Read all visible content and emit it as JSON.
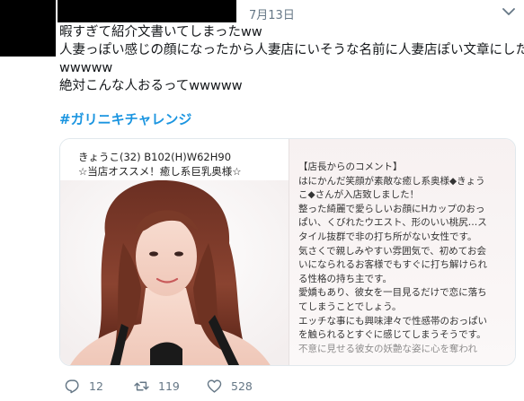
{
  "tweet": {
    "date": "7月13日",
    "lines": [
      "暇すぎて紹介文書いてしまったww",
      "人妻っぽい感じの顔になったから人妻店にいそうな名前に人妻店ぽい文章にした",
      "wwwww",
      "絶対こんな人おるってwwwww"
    ],
    "hashtag": "#ガリニキチャレンジ"
  },
  "media": {
    "profile_name": "きょうこ(32) B102(H)W62H90",
    "profile_tag": "☆当店オススメ！癒し系巨乳奥様☆",
    "comment_lines": [
      "【店長からのコメント】",
      "はにかんだ笑顔が素敵な癒し系奥様◆きょう",
      "こ◆さんが入店致しました！",
      "整った綺麗で愛らしいお顔にHカップのおっ",
      "ぱい、くびれたウエスト、形のいい桃尻…ス",
      "タイル抜群で非の打ち所がない女性です。",
      "気さくで親しみやすい雰囲気で、初めてお会",
      "いになられるお客様でもすぐに打ち解けられ",
      "る性格の持ち主です。",
      "愛嬌もあり、彼女を一目見るだけで恋に落ち",
      "てしまうことでしょう。",
      "エッチな事にも興味津々で性感帯のおっぱい",
      "を触られるとすぐに感じてしまうそうです。",
      "不意に見せる彼女の妖艶な姿に心を奪われ"
    ]
  },
  "actions": {
    "reply_count": "12",
    "retweet_count": "119",
    "like_count": "528"
  },
  "colors": {
    "link": "#1b95e0",
    "muted": "#657786",
    "text": "#14171a"
  },
  "icons": [
    "caret-down-icon",
    "reply-icon",
    "retweet-icon",
    "like-icon"
  ]
}
